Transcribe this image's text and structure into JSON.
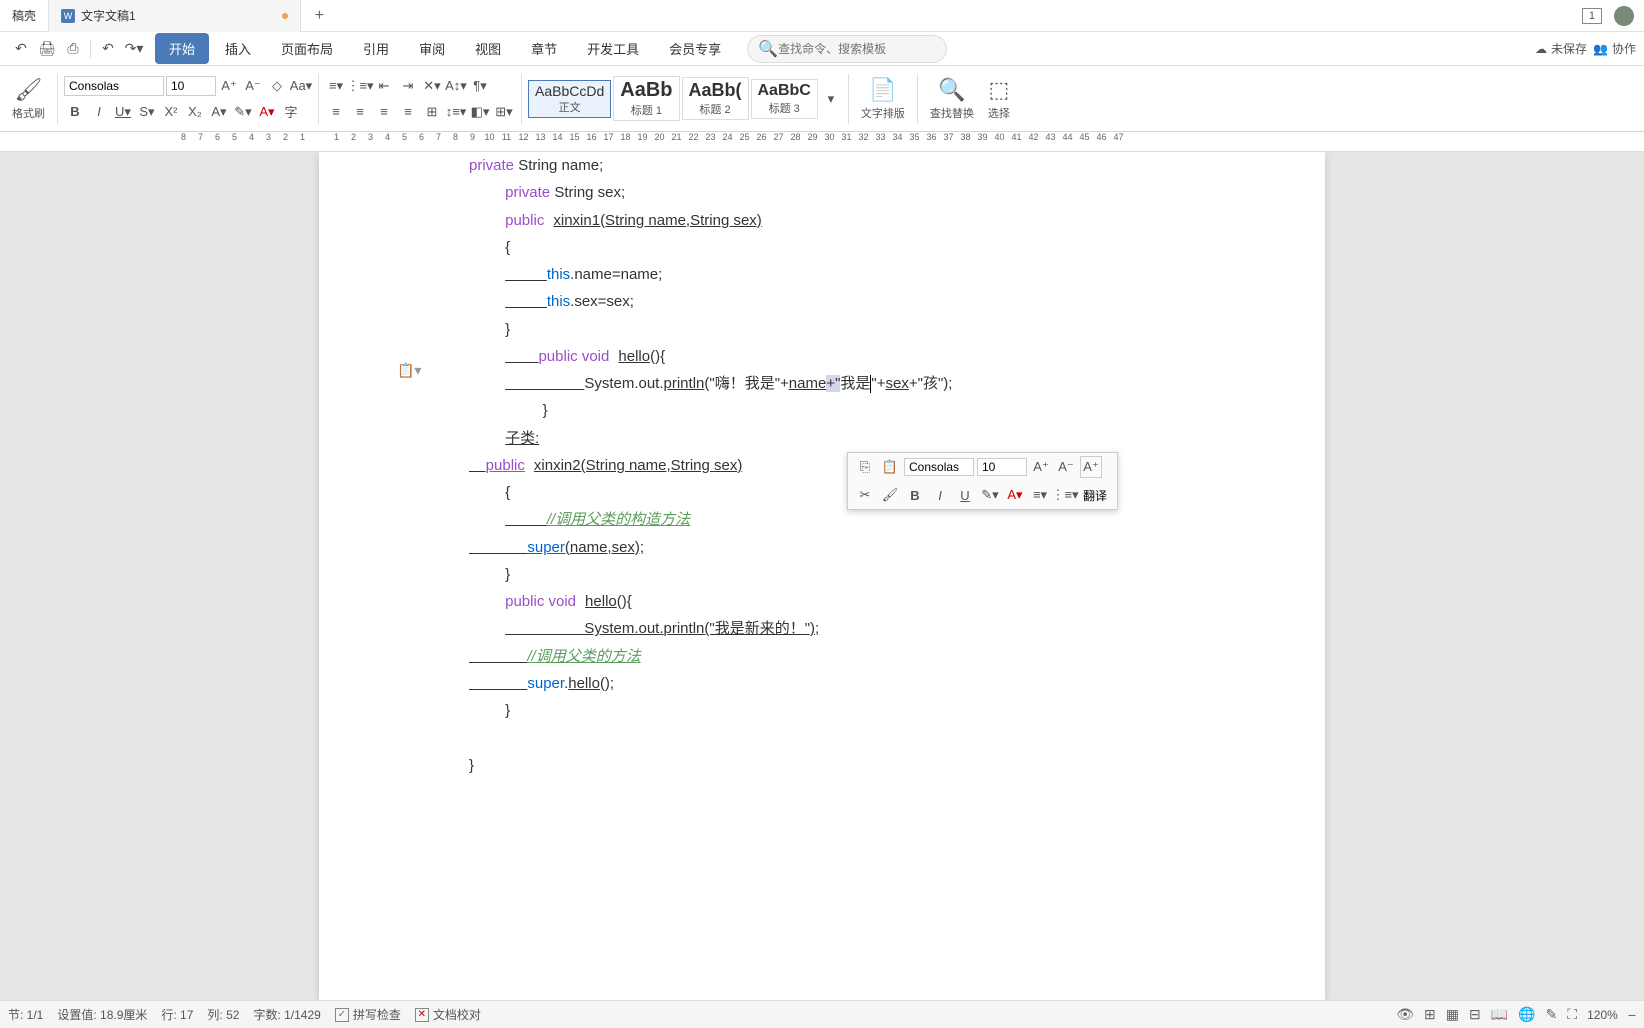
{
  "titlebar": {
    "tab1": "稿壳",
    "tab2": "文字文稿1",
    "win_num": "1"
  },
  "quickbar": {
    "undo": "↶",
    "menu": {
      "start": "开始",
      "insert": "插入",
      "layout": "页面布局",
      "reference": "引用",
      "review": "审阅",
      "view": "视图",
      "section": "章节",
      "devtools": "开发工具",
      "member": "会员专享"
    },
    "search_placeholder": "查找命令、搜索模板",
    "unsaved": "未保存",
    "collab": "协作"
  },
  "ribbon": {
    "format_painter": "格式刷",
    "font_name": "Consolas",
    "font_size": "10",
    "style_normal_preview": "AaBbCcDd",
    "style_normal": "正文",
    "style_h1_preview": "AaBb",
    "style_h1": "标题 1",
    "style_h2_preview": "AaBb(",
    "style_h2": "标题 2",
    "style_h3_preview": "AaBbC",
    "style_h3": "标题 3",
    "text_layout": "文字排版",
    "find_replace": "查找替换",
    "select": "选择"
  },
  "ruler": [
    "8",
    "7",
    "6",
    "5",
    "4",
    "3",
    "2",
    "1",
    "",
    "1",
    "2",
    "3",
    "4",
    "5",
    "6",
    "7",
    "8",
    "9",
    "10",
    "11",
    "12",
    "13",
    "14",
    "15",
    "16",
    "17",
    "18",
    "19",
    "20",
    "21",
    "22",
    "23",
    "24",
    "25",
    "26",
    "27",
    "28",
    "29",
    "30",
    "31",
    "32",
    "33",
    "34",
    "35",
    "36",
    "37",
    "38",
    "39",
    "40",
    "41",
    "42",
    "43",
    "44",
    "45",
    "46",
    "47"
  ],
  "code": {
    "l0_kw": "private",
    "l0_rest": " String name;",
    "l1_kw": "private",
    "l1_rest": " String sex;",
    "l2_kw": "public",
    "l2_fn": "xinxin1",
    "l2_sig": "(String name,String sex)",
    "l3": "{",
    "l4_pre": "          ",
    "l4_this": "this",
    "l4_rest": ".name=name;",
    "l5_pre": "          ",
    "l5_this": "this",
    "l5_rest": ".sex=sex;",
    "l6": "}",
    "l7_pre": "        ",
    "l7_kw": "public void",
    "l7_fn": "hello",
    "l7_rest": "(){",
    "l8_pre": "                   ",
    "l8_sys": "System.out.",
    "l8_fn": "println",
    "l8_s1": "(\"嗨！我是\"+",
    "l8_name": "name",
    "l8_s2": "+\"",
    "l8_s3": "我是",
    "l8_s4": "\"+",
    "l8_sex": "sex",
    "l8_s5": "+\"孩\");",
    "l9": "         }",
    "l10": "子类:",
    "l11_pre": "    ",
    "l11_kw": "public",
    "l11_fn": "xinxin2",
    "l11_sig": "(String name,String sex)",
    "l12": "{",
    "l13_pre": "          ",
    "l13_comment": "//调用父类的构造方法",
    "l14_pre": "              ",
    "l14_super": "super",
    "l14_rest": "(name,sex);",
    "l15": "}",
    "l16_kw": "public void",
    "l16_fn": "hello",
    "l16_rest": "(){",
    "l17_pre": "                   ",
    "l17_sys": "System.out.",
    "l17_fn": "println",
    "l17_rest": "(\"我是新来的！\");",
    "l18_pre": "              ",
    "l18_comment": "//调用父类的方法",
    "l19_pre": "              ",
    "l19_super": "super",
    "l19_dot": ".",
    "l19_fn": "hello",
    "l19_rest": "();",
    "l20": "}",
    "l21": "",
    "l22": "}"
  },
  "mini": {
    "font_name": "Consolas",
    "font_size": "10",
    "translate": "翻译"
  },
  "status": {
    "section": "节: 1/1",
    "setvalue": "设置值: 18.9厘米",
    "row": "行: 17",
    "col": "列: 52",
    "wordcount": "字数: 1/1429",
    "spellcheck": "拼写检查",
    "doccheck": "文档校对",
    "zoom": "120%"
  }
}
